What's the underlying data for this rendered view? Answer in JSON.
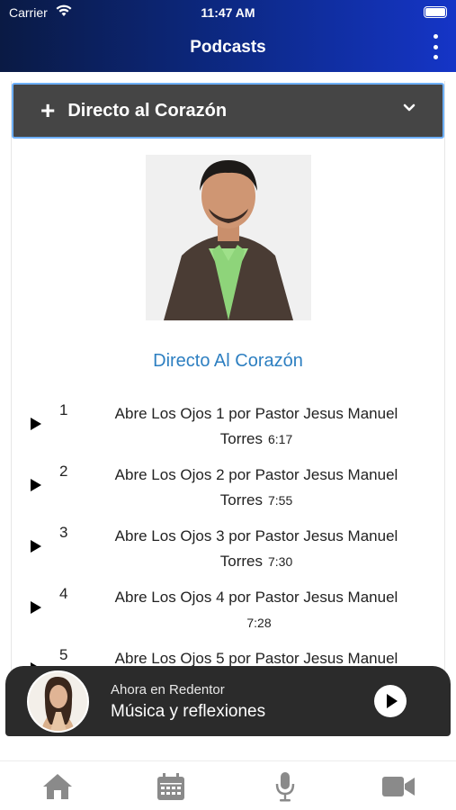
{
  "status_bar": {
    "carrier": "Carrier",
    "time": "11:47 AM"
  },
  "nav": {
    "title": "Podcasts",
    "more_icon": "more-vertical-icon"
  },
  "accordion": {
    "icon": "+",
    "title": "Directo al Corazón",
    "chevron_icon": "chevron-down-icon"
  },
  "show": {
    "title": "Directo Al Corazón",
    "accent_color": "#2d7fc1"
  },
  "episodes": [
    {
      "number": "1",
      "title_line1": "Abre Los Ojos 1 por Pastor Jesus Manuel",
      "title_line2": "Torres",
      "duration": "6:17"
    },
    {
      "number": "2",
      "title_line1": "Abre Los Ojos 2 por Pastor Jesus Manuel",
      "title_line2": "Torres",
      "duration": "7:55"
    },
    {
      "number": "3",
      "title_line1": "Abre Los Ojos 3 por Pastor Jesus Manuel",
      "title_line2": "Torres",
      "duration": "7:30"
    },
    {
      "number": "4",
      "title_line1": "Abre Los Ojos 4 por Pastor Jesus Manuel",
      "title_line2": "",
      "duration": "7:28"
    },
    {
      "number": "5",
      "title_line1": "Abre Los Ojos 5 por Pastor Jesus Manuel",
      "title_line2": "",
      "duration": ""
    }
  ],
  "now_playing": {
    "label": "Ahora en Redentor",
    "title": "Música y reflexiones"
  },
  "tabs": [
    {
      "icon": "home-icon"
    },
    {
      "icon": "calendar-icon"
    },
    {
      "icon": "microphone-icon"
    },
    {
      "icon": "video-camera-icon"
    }
  ],
  "colors": {
    "header_gradient_start": "#0a1a44",
    "header_gradient_end": "#1535c7",
    "accordion_bg": "#454545",
    "accordion_border": "#6db0ff",
    "tab_icon": "#8a8a8a"
  }
}
